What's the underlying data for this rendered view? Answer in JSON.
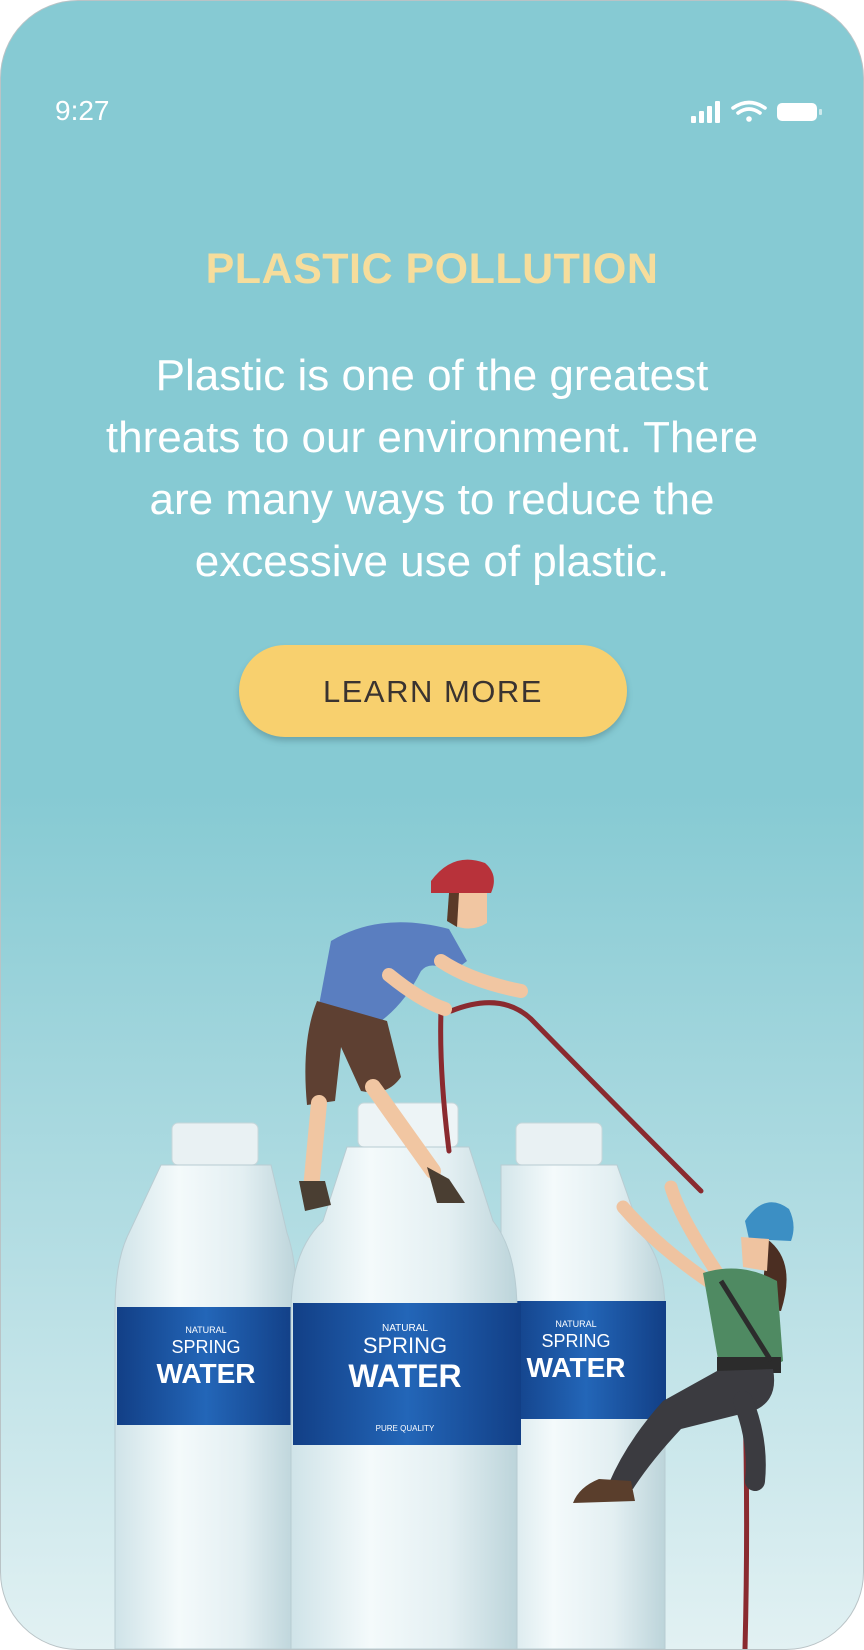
{
  "status_bar": {
    "time": "9:27",
    "icons": [
      "cellular-signal-icon",
      "wifi-icon",
      "battery-icon"
    ]
  },
  "hero": {
    "title": "PLASTIC POLLUTION",
    "body": "Plastic is one of the greatest threats to our environment. There are many ways to reduce the excessive use of plastic."
  },
  "cta": {
    "label": "LEARN MORE"
  },
  "illustration": {
    "bottle_label_top": "NATURAL",
    "bottle_label_main_1": "SPRING",
    "bottle_label_main_2": "WATER",
    "bottle_label_bottom": "PURE QUALITY"
  },
  "colors": {
    "background": "#86cad3",
    "title": "#f6dd9c",
    "button": "#f8d06e",
    "button_text": "#3a3330",
    "label_blue": "#1c5aa8"
  }
}
